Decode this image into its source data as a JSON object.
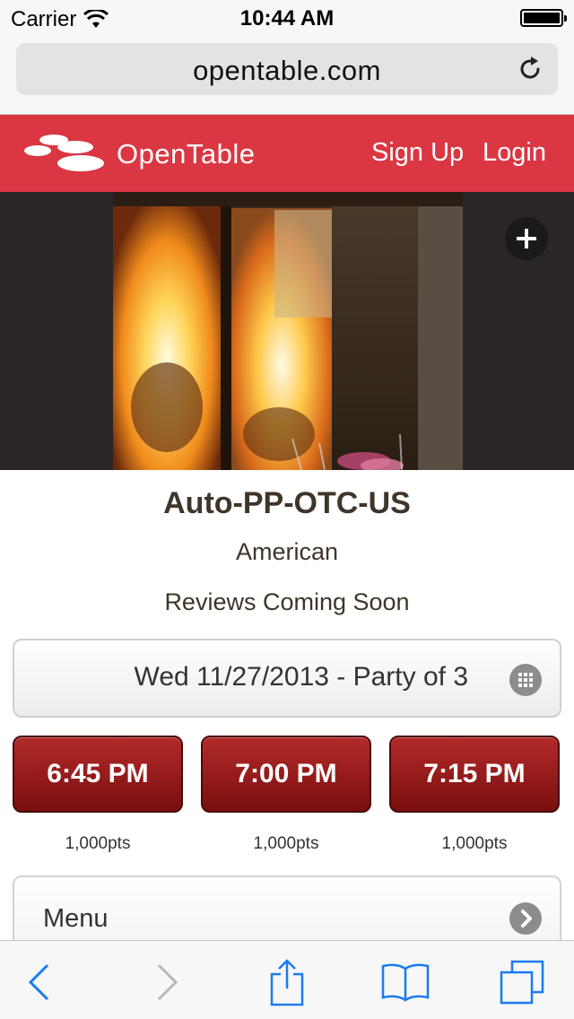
{
  "status_bar": {
    "carrier": "Carrier",
    "time": "10:44 AM"
  },
  "browser": {
    "url": "opentable.com"
  },
  "header": {
    "brand": "OpenTable",
    "sign_up": "Sign Up",
    "login": "Login",
    "brand_color": "#da3743"
  },
  "restaurant": {
    "name": "Auto-PP-OTC-US",
    "cuisine": "American",
    "reviews": "Reviews Coming Soon"
  },
  "reservation": {
    "selection": "Wed 11/27/2013 - Party of 3"
  },
  "time_slots": [
    {
      "time": "6:45 PM",
      "points": "1,000pts"
    },
    {
      "time": "7:00 PM",
      "points": "1,000pts"
    },
    {
      "time": "7:15 PM",
      "points": "1,000pts"
    }
  ],
  "menu": {
    "label": "Menu"
  },
  "colors": {
    "slot_red": "#9a1c1c",
    "ios_blue": "#1a7bf2"
  }
}
